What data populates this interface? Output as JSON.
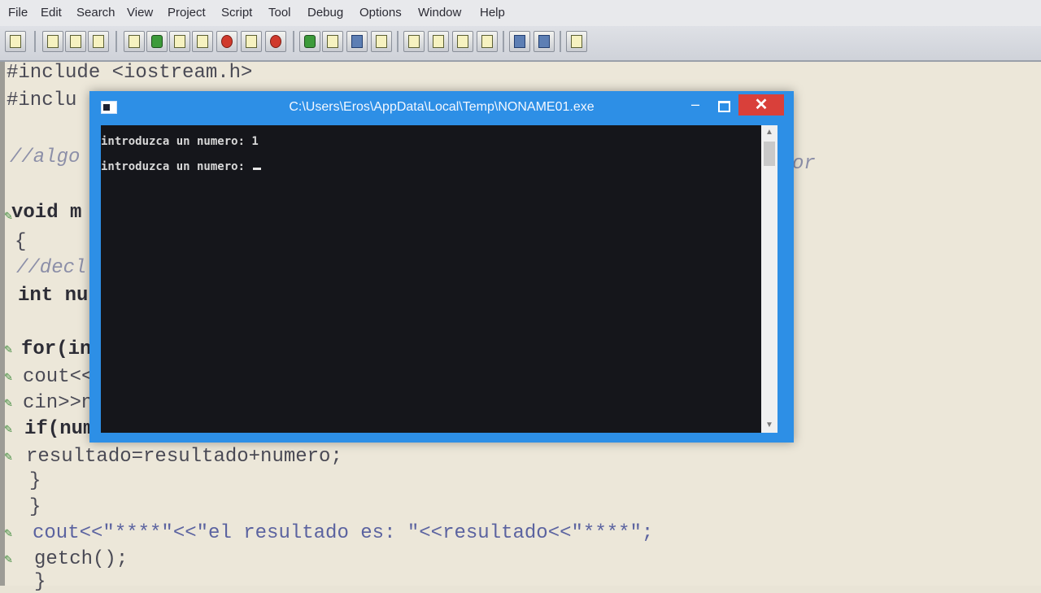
{
  "menubar": {
    "items": [
      "File",
      "Edit",
      "Search",
      "View",
      "Project",
      "Script",
      "Tool",
      "Debug",
      "Options",
      "Window",
      "Help"
    ]
  },
  "editor": {
    "lines": [
      "#include <iostream.h>",
      "#inclu",
      "//algo",
      "or",
      "void m",
      "{",
      "//decl",
      "int nu",
      "for(in",
      "cout<<",
      "cin>>n",
      "if(num",
      "resultado=resultado+numero;",
      "}",
      "}",
      "cout<<\"****\"<<\"el resultado es: \"<<resultado<<\"****\";",
      "getch();",
      "}"
    ]
  },
  "console": {
    "title": "C:\\Users\\Eros\\AppData\\Local\\Temp\\NONAME01.exe",
    "minimize": "–",
    "close": "✕",
    "lines": [
      "introduzca un numero: 1",
      "introduzca un numero: "
    ]
  },
  "colors": {
    "console_frame": "#2d8fe6",
    "console_bg": "#15161b",
    "close_button": "#d9403a",
    "editor_bg": "#ece7d9"
  }
}
